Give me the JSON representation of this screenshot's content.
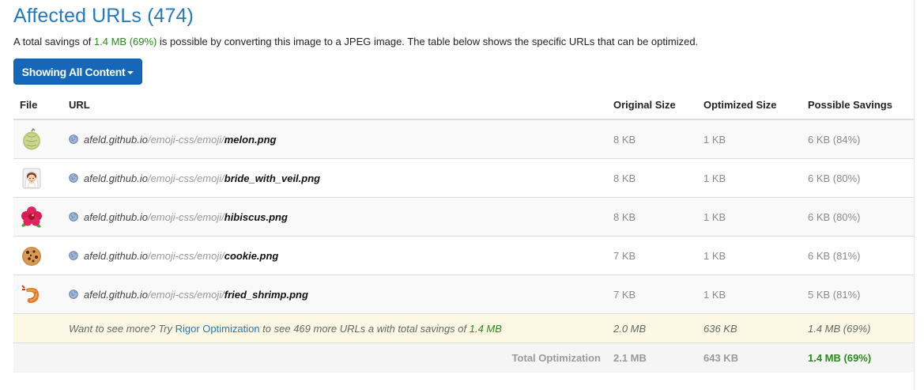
{
  "heading": "Affected URLs (474)",
  "summary": {
    "prefix": "A total savings of ",
    "savings": "1.4 MB (69%)",
    "suffix": " is possible by converting this image to a JPEG image. The table below shows the specific URLs that can be optimized."
  },
  "filter_button": {
    "label": "Showing All Content",
    "icon": "caret-down-icon"
  },
  "columns": {
    "file": "File",
    "url": "URL",
    "original": "Original Size",
    "optimized": "Optimized Size",
    "savings": "Possible Savings"
  },
  "rows": [
    {
      "icon": "melon-emoji",
      "host": "afeld.github.io",
      "path": "/emoji-css/emoji/",
      "file": "melon.png",
      "original": "8 KB",
      "optimized": "1 KB",
      "savings": "6 KB (84%)"
    },
    {
      "icon": "bride-with-veil-emoji",
      "host": "afeld.github.io",
      "path": "/emoji-css/emoji/",
      "file": "bride_with_veil.png",
      "original": "8 KB",
      "optimized": "1 KB",
      "savings": "6 KB (80%)"
    },
    {
      "icon": "hibiscus-emoji",
      "host": "afeld.github.io",
      "path": "/emoji-css/emoji/",
      "file": "hibiscus.png",
      "original": "8 KB",
      "optimized": "1 KB",
      "savings": "6 KB (80%)"
    },
    {
      "icon": "cookie-emoji",
      "host": "afeld.github.io",
      "path": "/emoji-css/emoji/",
      "file": "cookie.png",
      "original": "7 KB",
      "optimized": "1 KB",
      "savings": "6 KB (81%)"
    },
    {
      "icon": "fried-shrimp-emoji",
      "host": "afeld.github.io",
      "path": "/emoji-css/emoji/",
      "file": "fried_shrimp.png",
      "original": "7 KB",
      "optimized": "1 KB",
      "savings": "5 KB (81%)"
    }
  ],
  "more_row": {
    "prefix": "Want to see more? Try ",
    "link": "Rigor Optimization",
    "middle": " to see 469 more URLs a with total savings of ",
    "savings": "1.4 MB",
    "original": "2.0 MB",
    "optimized": "636 KB",
    "possible": "1.4 MB (69%)"
  },
  "total_row": {
    "label": "Total Optimization",
    "original": "2.1 MB",
    "optimized": "643 KB",
    "savings": "1.4 MB (69%)"
  },
  "colors": {
    "heading": "#2579bf",
    "green": "#2a8a1a",
    "button": "#1467b9",
    "more_bg": "#fcf8e3"
  }
}
